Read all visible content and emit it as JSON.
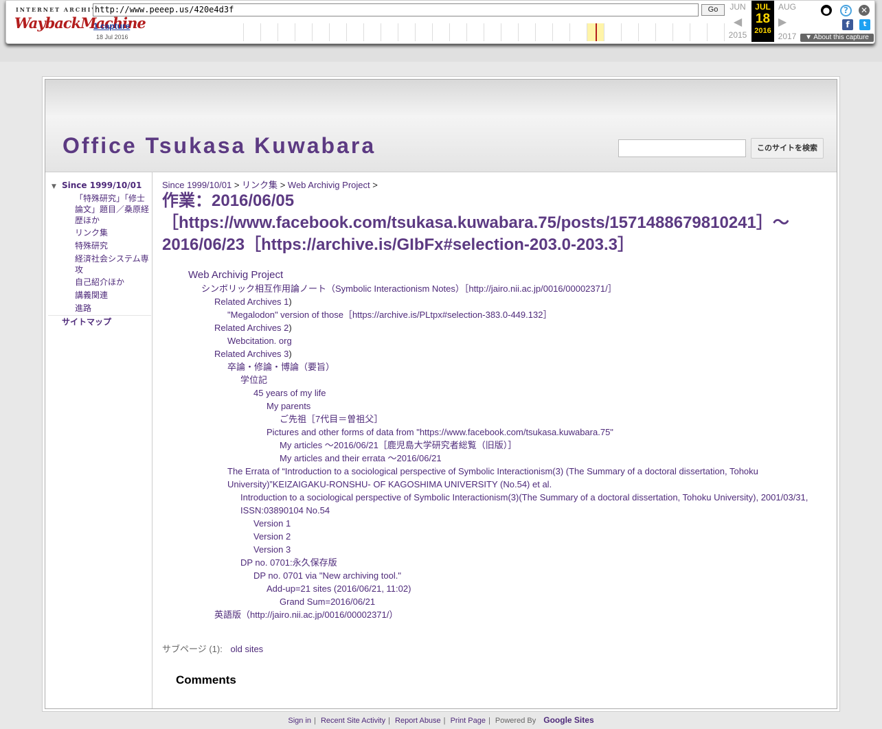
{
  "wayback": {
    "logo_top": "INTERNET ARCHIVE",
    "logo_main": "WaybackMachine",
    "url": "http://www.peeep.us/420e4d3f",
    "go_label": "Go",
    "captures_label": "1 capture",
    "capture_date": "18 Jul 2016",
    "prev_month": "JUN",
    "cur_month": "JUL",
    "next_month": "AUG",
    "cur_day": "18",
    "prev_year": "2015",
    "cur_year": "2016",
    "next_year": "2017",
    "about_label": "About this capture",
    "colors": {
      "accent": "#b31d1d",
      "current_bg": "#000000",
      "current_fg": "#ffd700"
    }
  },
  "site": {
    "title": "Office Tsukasa Kuwabara",
    "search_button": "このサイトを検索",
    "title_color": "#5c3a82"
  },
  "sidebar": {
    "root": "Since 1999/10/01",
    "items": [
      "「特殊研究」「修士論文」題目／桑原経歴ほか",
      "リンク集",
      "特殊研究",
      "経済社会システム専攻",
      "自己紹介ほか",
      "講義関連",
      "進路"
    ],
    "sitemap": "サイトマップ"
  },
  "breadcrumb": {
    "items": [
      "Since 1999/10/01",
      "リンク集",
      "Web Archivig Project"
    ],
    "sep": ">"
  },
  "page_title": "作業：2016/06/05［https://www.facebook.com/tsukasa.kuwabara.75/posts/1571488679810241］～2016/06/23［https://archive.is/GIbFx#selection-203.0-203.3］",
  "tree": [
    {
      "text": "Web Archivig Project",
      "level": 0,
      "big": true
    },
    {
      "text": "シンボリック相互作用論ノート（Symbolic Interactionism Notes）［http://jairo.nii.ac.jp/0016/00002371/］",
      "level": 1
    },
    {
      "text": "Related Archives 1",
      "tail": ")",
      "level": 2
    },
    {
      "text": "\"Megalodon\" version of those［https://archive.is/PLtpx#selection-383.0-449.132］",
      "level": 3
    },
    {
      "text": "Related Archives 2",
      "tail": ")",
      "level": 2
    },
    {
      "text": "Webcitation. org",
      "level": 3
    },
    {
      "text": "Related Archives 3",
      "tail": ")",
      "level": 2
    },
    {
      "text": "卒論・修論・博論（要旨）",
      "level": 3
    },
    {
      "text": "学位記",
      "level": 4
    },
    {
      "text": "45 years of my life",
      "level": 5
    },
    {
      "text": "My parents",
      "level": 6
    },
    {
      "text": "ご先祖［7代目＝曽祖父］",
      "level": 7
    },
    {
      "text": "Pictures and other forms of data from \"https://www.facebook.com/tsukasa.kuwabara.75\"",
      "level": 6
    },
    {
      "text": "My articles ～2016/06/21［鹿児島大学研究者総覧（旧版）］",
      "level": 7
    },
    {
      "text": "My articles and their errata ～2016/06/21",
      "level": 7
    },
    {
      "text": "The Errata of “Introduction to a sociological perspective of Symbolic Interactionism(3) (The Summary of a doctoral dissertation, Tohoku",
      "level": 3
    },
    {
      "text": "University)”KEIZAIGAKU-RONSHU- OF KAGOSHIMA UNIVERSITY (No.54) et al.",
      "level": 3
    },
    {
      "text": "Introduction to a sociological perspective of Symbolic Interactionism(3)(The Summary of a doctoral dissertation, Tohoku University), 2001/03/31,",
      "level": 4
    },
    {
      "text": "ISSN:03890104 No.54",
      "level": 4
    },
    {
      "text": "Version 1",
      "level": 5
    },
    {
      "text": "Version 2",
      "level": 5
    },
    {
      "text": "Version 3",
      "level": 5
    },
    {
      "text": "DP no. 0701:永久保存版",
      "level": 4
    },
    {
      "text": "DP no. 0701 via \"New archiving tool.\"",
      "level": 5
    },
    {
      "text": "Add-up=21 sites (2016/06/21, 11:02)",
      "level": 6
    },
    {
      "text": "Grand Sum=2016/06/21",
      "level": 7
    },
    {
      "text": "英語版（http://jairo.nii.ac.jp/0016/00002371/）",
      "level": 2
    }
  ],
  "subpages": {
    "label": "サブページ (1):",
    "link": "old sites"
  },
  "comments": "Comments",
  "footer": {
    "links": [
      "Sign in",
      "Recent Site Activity",
      "Report Abuse",
      "Print Page"
    ],
    "powered": "Powered By",
    "brand": "Google Sites"
  }
}
